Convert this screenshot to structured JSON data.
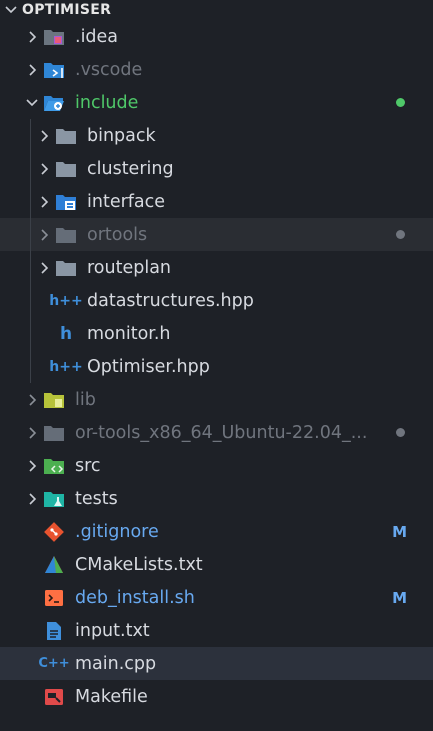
{
  "explorer": {
    "title": "OPTIMISER",
    "items": [
      {
        "label": ".idea",
        "icon": "idea-folder-icon",
        "kind": "folder"
      },
      {
        "label": ".vscode",
        "icon": "vscode-folder-icon",
        "kind": "folder"
      },
      {
        "label": "include",
        "icon": "include-folder-open-icon",
        "kind": "folder"
      },
      {
        "label": "binpack",
        "icon": "folder-icon",
        "kind": "folder"
      },
      {
        "label": "clustering",
        "icon": "folder-icon",
        "kind": "folder"
      },
      {
        "label": "interface",
        "icon": "interface-folder-icon",
        "kind": "folder"
      },
      {
        "label": "ortools",
        "icon": "folder-icon",
        "kind": "folder"
      },
      {
        "label": "routeplan",
        "icon": "folder-icon",
        "kind": "folder"
      },
      {
        "label": "datastructures.hpp",
        "icon": "hpp-file-icon",
        "kind": "file",
        "glyph": "h++"
      },
      {
        "label": "monitor.h",
        "icon": "h-file-icon",
        "kind": "file",
        "glyph": "h"
      },
      {
        "label": "Optimiser.hpp",
        "icon": "hpp-file-icon",
        "kind": "file",
        "glyph": "h++"
      },
      {
        "label": "lib",
        "icon": "lib-folder-icon",
        "kind": "folder"
      },
      {
        "label": "or-tools_x86_64_Ubuntu-22.04_...",
        "icon": "folder-icon",
        "kind": "folder"
      },
      {
        "label": "src",
        "icon": "src-folder-icon",
        "kind": "folder"
      },
      {
        "label": "tests",
        "icon": "tests-folder-icon",
        "kind": "folder"
      },
      {
        "label": ".gitignore",
        "icon": "git-icon",
        "kind": "file",
        "badge": "M"
      },
      {
        "label": "CMakeLists.txt",
        "icon": "cmake-icon",
        "kind": "file"
      },
      {
        "label": "deb_install.sh",
        "icon": "shell-icon",
        "kind": "file",
        "badge": "M"
      },
      {
        "label": "input.txt",
        "icon": "text-file-icon",
        "kind": "file"
      },
      {
        "label": "main.cpp",
        "icon": "cpp-file-icon",
        "kind": "file",
        "glyph": "C++"
      },
      {
        "label": "Makefile",
        "icon": "makefile-icon",
        "kind": "file"
      }
    ]
  },
  "colors": {
    "background": "#1e2127",
    "git_added": "#4fc869",
    "git_modified": "#68a9f0",
    "ignored": "#70757e",
    "folder": "#8a96a4"
  }
}
